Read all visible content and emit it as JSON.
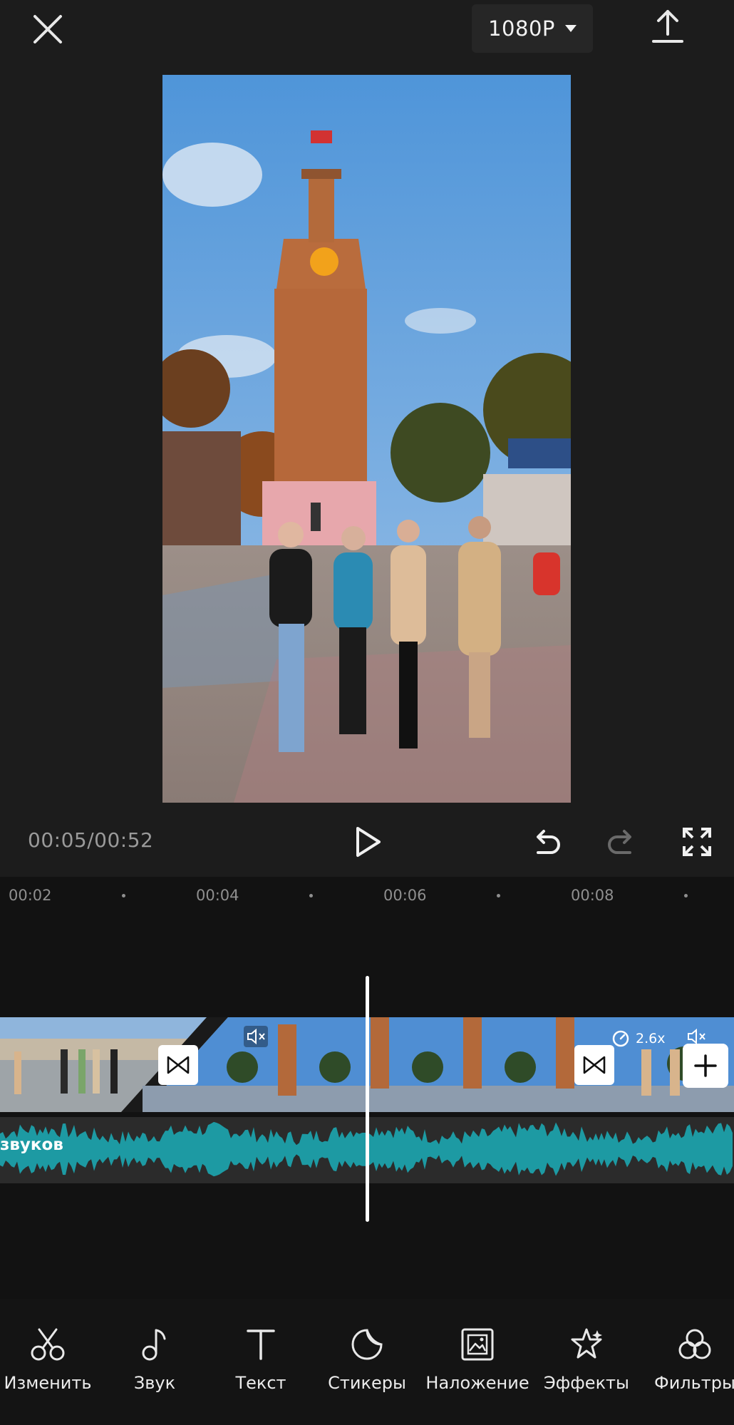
{
  "header": {
    "resolution": "1080P",
    "close_icon": "close-icon",
    "dropdown_icon": "caret-down-icon",
    "export_icon": "export-upload-icon"
  },
  "player": {
    "timecode": "00:05/00:52",
    "play_icon": "play-icon",
    "undo_icon": "undo-icon",
    "redo_icon": "redo-icon",
    "fullscreen_icon": "fullscreen-icon"
  },
  "timeline": {
    "ruler": [
      "00:02",
      "00:04",
      "00:06",
      "00:08"
    ],
    "clip_speed": "2.6x",
    "audio_label": "звуков",
    "waveform_color": "#1d9aa3"
  },
  "toolbar": {
    "items": [
      {
        "label": "Изменить",
        "icon": "scissors-icon"
      },
      {
        "label": "Звук",
        "icon": "music-note-icon"
      },
      {
        "label": "Текст",
        "icon": "text-icon"
      },
      {
        "label": "Стикеры",
        "icon": "sticker-icon"
      },
      {
        "label": "Наложение",
        "icon": "overlay-icon"
      },
      {
        "label": "Эффекты",
        "icon": "effects-star-icon"
      },
      {
        "label": "Фильтры",
        "icon": "filters-icon"
      }
    ]
  },
  "colors": {
    "background": "#1c1c1c",
    "timeline_bg": "#121212",
    "accent_waveform": "#1d9aa3"
  }
}
